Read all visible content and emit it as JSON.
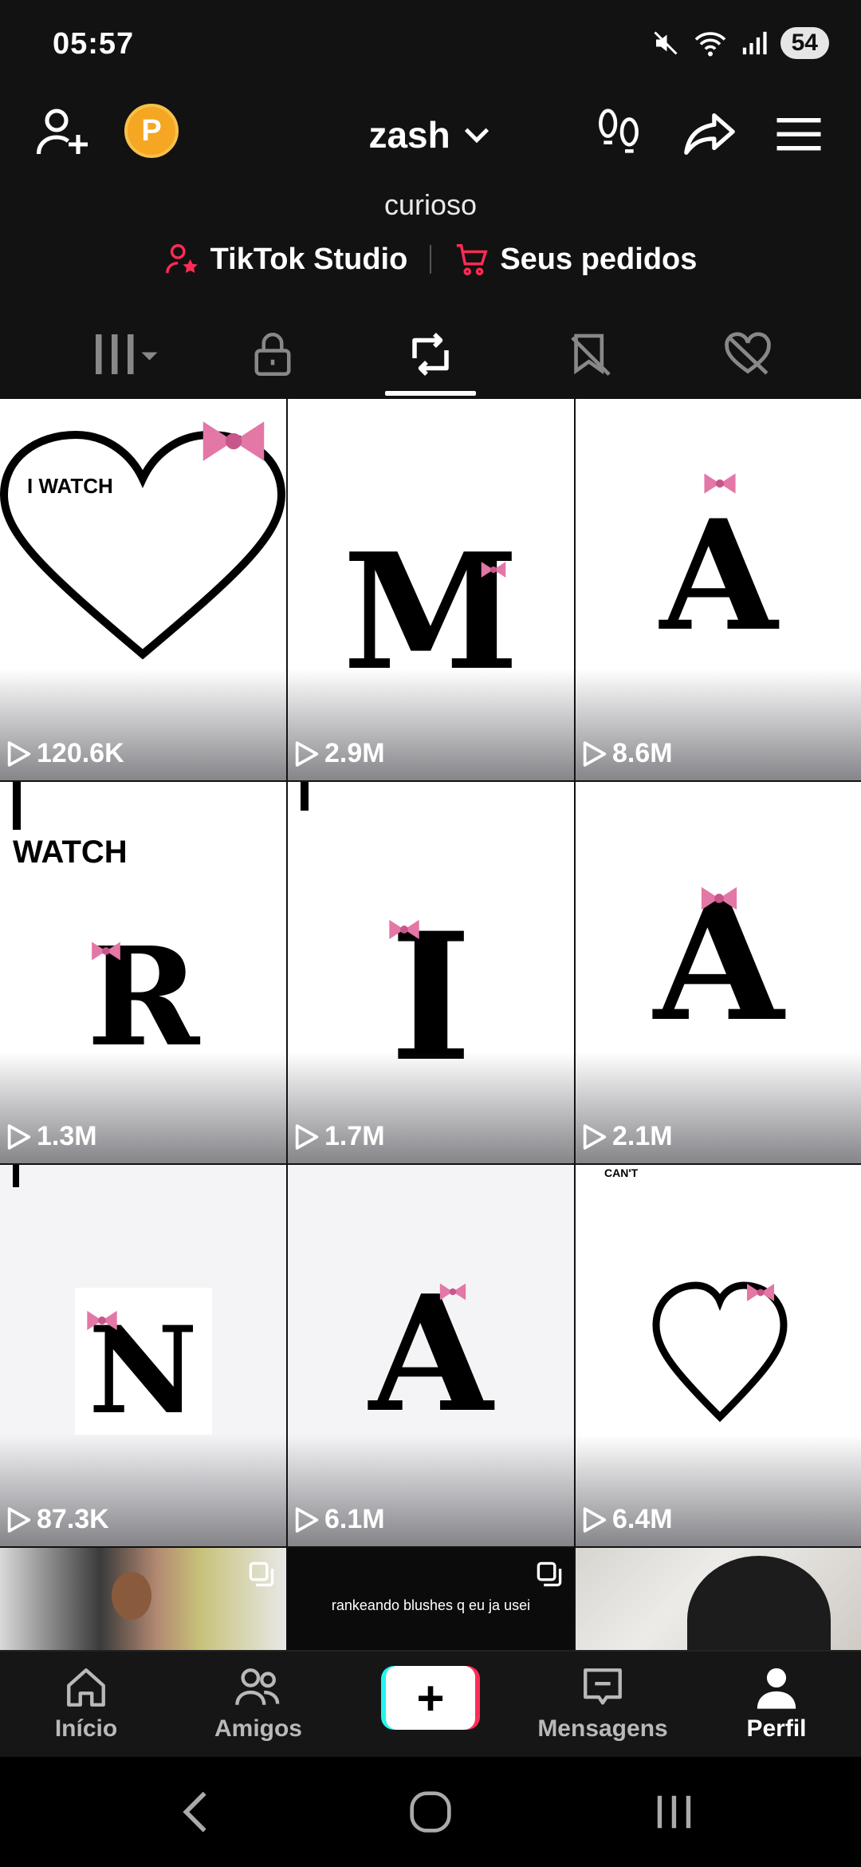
{
  "status": {
    "time": "05:57",
    "battery": "54"
  },
  "header": {
    "username": "zash",
    "bio": "curioso",
    "coin_label": "P",
    "links": [
      {
        "label": "TikTok Studio",
        "icon": "person-star-icon"
      },
      {
        "label": "Seus pedidos",
        "icon": "cart-icon"
      }
    ]
  },
  "tabs": [
    {
      "icon": "grid-icon"
    },
    {
      "icon": "lock-icon"
    },
    {
      "icon": "repost-icon",
      "active": true
    },
    {
      "icon": "bookmark-icon"
    },
    {
      "icon": "liked-icon"
    }
  ],
  "videos": [
    {
      "views": "120.6K",
      "overlay": "I WATCH"
    },
    {
      "views": "2.9M",
      "overlay": "M"
    },
    {
      "views": "8.6M",
      "overlay": "A"
    },
    {
      "views": "1.3M",
      "overlay": "R",
      "top_text": "WATCH"
    },
    {
      "views": "1.7M",
      "overlay": "I"
    },
    {
      "views": "2.1M",
      "overlay": "A"
    },
    {
      "views": "87.3K",
      "overlay": "N"
    },
    {
      "views": "6.1M",
      "overlay": "A"
    },
    {
      "views": "6.4M",
      "overlay": "",
      "top_text": "CAN'T"
    },
    {
      "views": "",
      "overlay": ""
    },
    {
      "views": "",
      "overlay": "",
      "caption": "rankeando blushes q eu ja usei"
    },
    {
      "views": "",
      "overlay": ""
    }
  ],
  "nav": {
    "home": "Início",
    "friends": "Amigos",
    "inbox": "Mensagens",
    "profile": "Perfil"
  },
  "colors": {
    "accent_red": "#fe2c55",
    "accent_cyan": "#25f4ee",
    "coin": "#f5a623",
    "bow_pink": "#e377a6"
  }
}
